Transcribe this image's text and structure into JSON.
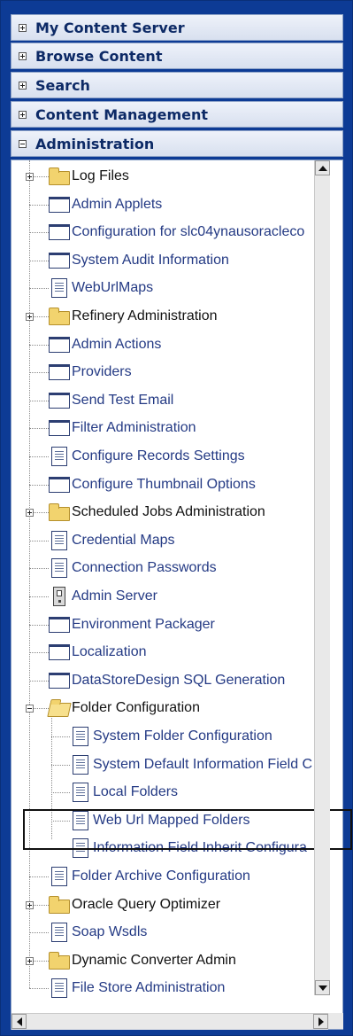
{
  "panels": [
    {
      "label": "My Content Server",
      "expanded": false
    },
    {
      "label": "Browse Content",
      "expanded": false
    },
    {
      "label": "Search",
      "expanded": false
    },
    {
      "label": "Content Management",
      "expanded": false
    },
    {
      "label": "Administration",
      "expanded": true
    }
  ],
  "tree": [
    {
      "label": "Log Files",
      "icon": "folder-icon",
      "level": 0,
      "expander": "plus"
    },
    {
      "label": "Admin Applets",
      "icon": "window-icon",
      "level": 0
    },
    {
      "label": "Configuration for slc04ynausoracleco",
      "icon": "window-icon",
      "level": 0
    },
    {
      "label": "System Audit Information",
      "icon": "window-icon",
      "level": 0
    },
    {
      "label": "WebUrlMaps",
      "icon": "page-icon",
      "level": 0
    },
    {
      "label": "Refinery Administration",
      "icon": "folder-icon",
      "level": 0,
      "expander": "plus"
    },
    {
      "label": "Admin Actions",
      "icon": "window-icon",
      "level": 0
    },
    {
      "label": "Providers",
      "icon": "window-icon",
      "level": 0
    },
    {
      "label": "Send Test Email",
      "icon": "window-icon",
      "level": 0
    },
    {
      "label": "Filter Administration",
      "icon": "window-icon",
      "level": 0
    },
    {
      "label": "Configure Records Settings",
      "icon": "page-icon",
      "level": 0
    },
    {
      "label": "Configure Thumbnail Options",
      "icon": "window-icon",
      "level": 0
    },
    {
      "label": "Scheduled Jobs Administration",
      "icon": "folder-icon",
      "level": 0,
      "expander": "plus"
    },
    {
      "label": "Credential Maps",
      "icon": "page-icon",
      "level": 0
    },
    {
      "label": "Connection Passwords",
      "icon": "page-icon",
      "level": 0
    },
    {
      "label": "Admin Server",
      "icon": "server-icon",
      "level": 0
    },
    {
      "label": "Environment Packager",
      "icon": "window-icon",
      "level": 0
    },
    {
      "label": "Localization",
      "icon": "window-icon",
      "level": 0
    },
    {
      "label": "DataStoreDesign SQL Generation",
      "icon": "window-icon",
      "level": 0
    },
    {
      "label": "Folder Configuration",
      "icon": "folder-open-icon",
      "level": 0,
      "expander": "minus"
    },
    {
      "label": "System Folder Configuration",
      "icon": "page-icon",
      "level": 1
    },
    {
      "label": "System Default Information Field C",
      "icon": "page-icon",
      "level": 1
    },
    {
      "label": "Local Folders",
      "icon": "page-icon",
      "level": 1
    },
    {
      "label": "Web Url Mapped Folders",
      "icon": "page-icon",
      "level": 1,
      "highlighted": true
    },
    {
      "label": "Information Field Inherit Configura",
      "icon": "page-icon",
      "level": 1
    },
    {
      "label": "Folder Archive Configuration",
      "icon": "page-icon",
      "level": 0
    },
    {
      "label": "Oracle Query Optimizer",
      "icon": "folder-icon",
      "level": 0,
      "expander": "plus"
    },
    {
      "label": "Soap Wsdls",
      "icon": "page-icon",
      "level": 0
    },
    {
      "label": "Dynamic Converter Admin",
      "icon": "folder-icon",
      "level": 0,
      "expander": "plus"
    },
    {
      "label": "File Store Administration",
      "icon": "page-icon",
      "level": 0
    }
  ],
  "colors": {
    "frame": "#0d3b95",
    "link": "#243a84",
    "folder": "#f2d36e",
    "panel": "#dde4f2"
  }
}
